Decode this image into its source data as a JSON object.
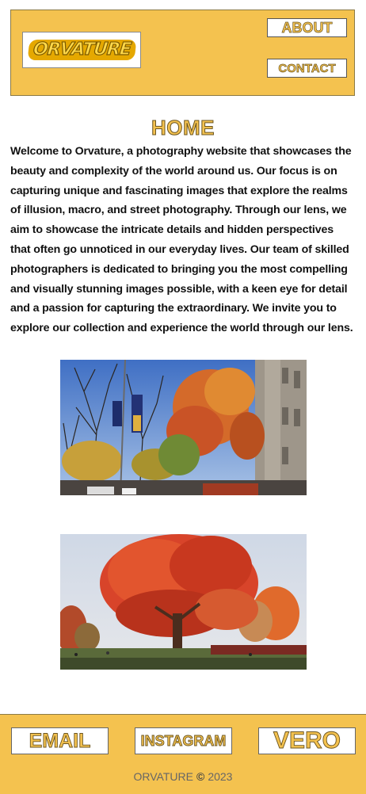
{
  "header": {
    "logo_text": "ORVATURE",
    "nav": {
      "about": "ABOUT",
      "contact": "CONTACT"
    }
  },
  "main": {
    "title": "HOME",
    "intro": "Welcome to Orvature, a photography website that showcases the beauty and complexity of the world around us. Our focus is on capturing unique and fascinating images that explore the realms of illusion, macro, and street photography. Through our lens, we aim to showcase the intricate details and hidden perspectives that often go unnoticed in our everyday lives. Our team of skilled photographers is dedicated to bringing you the most compelling and visually stunning images possible, with a keen eye for detail and a passion for capturing the extraordinary. We invite you to explore our collection and experience the world through our lens."
  },
  "footer": {
    "email": "EMAIL",
    "instagram": "INSTAGRAM",
    "vero": "VERO",
    "brand": "ORVATURE",
    "copyright_symbol": "©",
    "year": "2023"
  },
  "colors": {
    "accent": "#f4c24f",
    "outline": "#6b5520",
    "text": "#111111"
  },
  "icons": {
    "logo": "orvature-logo",
    "photo_1": "autumn-street-trees-photo",
    "photo_2": "red-maple-tree-photo"
  }
}
